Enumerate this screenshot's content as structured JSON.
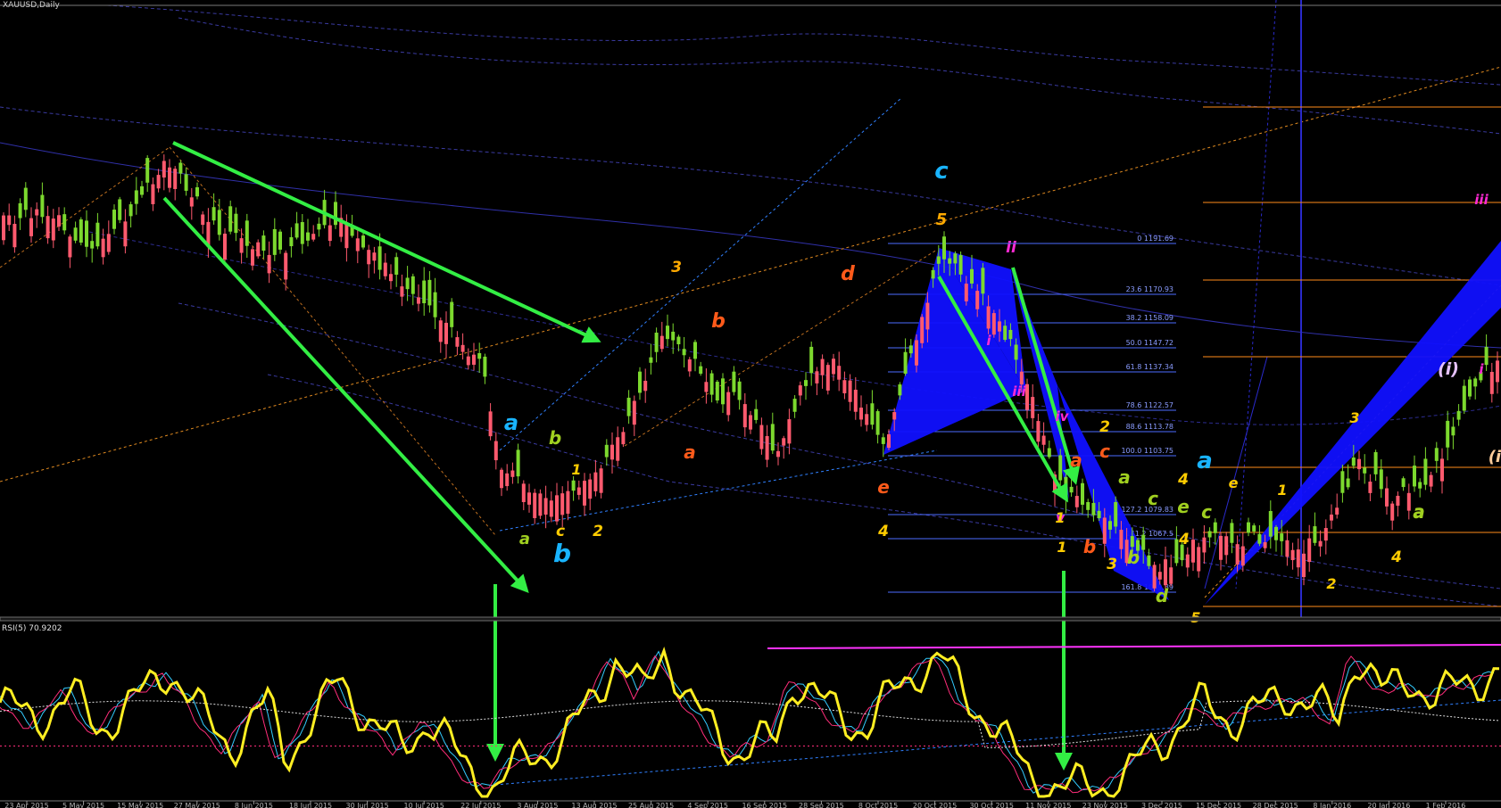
{
  "window": {
    "symbol_label": "XAUUSD,Daily"
  },
  "colors": {
    "background": "#000000",
    "bull_candle": "#7cd92e",
    "bear_candle": "#ff5a6e",
    "arrow": "#33ee44",
    "fib_line": "#4d6cff",
    "pattern_fill": "#1010ff",
    "rsi_line": "#ffee22",
    "rsi_signal_a": "#33ccff",
    "rsi_signal_b": "#ff2d7a",
    "rsi_level": "#ff33ff",
    "orange_level": "#ff8c1a"
  },
  "rsi_panel": {
    "label": "RSI(5) 70.9202"
  },
  "fib_levels": [
    {
      "label": "0 1191.69"
    },
    {
      "label": "23.6 1170.93"
    },
    {
      "label": "38.2 1158.09"
    },
    {
      "label": "50.0 1147.72"
    },
    {
      "label": "61.8 1137.34"
    },
    {
      "label": "78.6 1122.57"
    },
    {
      "label": "88.6 1113.78"
    },
    {
      "label": "100.0 1103.75"
    },
    {
      "label": "127.2 1079.83"
    },
    {
      "label": "141.2 1067.5"
    },
    {
      "label": "161.8 1049.39"
    }
  ],
  "wave_labels": [
    {
      "text": "c"
    },
    {
      "text": "a"
    },
    {
      "text": "b"
    },
    {
      "text": "3"
    },
    {
      "text": "b"
    },
    {
      "text": "d"
    },
    {
      "text": "5"
    },
    {
      "text": "ii"
    },
    {
      "text": "i"
    },
    {
      "text": "iii"
    },
    {
      "text": "iv"
    },
    {
      "text": "a"
    },
    {
      "text": "c"
    },
    {
      "text": "2"
    },
    {
      "text": "a"
    },
    {
      "text": "c"
    },
    {
      "text": "e"
    },
    {
      "text": "4"
    },
    {
      "text": "a"
    },
    {
      "text": "b"
    },
    {
      "text": "1"
    },
    {
      "text": "a"
    },
    {
      "text": "c"
    },
    {
      "text": "2"
    },
    {
      "text": "e"
    },
    {
      "text": "4"
    },
    {
      "text": "1"
    },
    {
      "text": "b"
    },
    {
      "text": "3"
    },
    {
      "text": "b"
    },
    {
      "text": "d"
    },
    {
      "text": "5"
    },
    {
      "text": "a"
    },
    {
      "text": "4"
    },
    {
      "text": "a"
    },
    {
      "text": "c"
    },
    {
      "text": "e"
    },
    {
      "text": "v"
    },
    {
      "text": "1"
    },
    {
      "text": "3"
    },
    {
      "text": "1"
    },
    {
      "text": "2"
    },
    {
      "text": "a"
    },
    {
      "text": "4"
    },
    {
      "text": "(i)"
    },
    {
      "text": "i"
    },
    {
      "text": "iii"
    },
    {
      "text": "(ii"
    }
  ],
  "x_axis_labels": [
    "23 Apr 2015",
    "5 May 2015",
    "15 May 2015",
    "27 May 2015",
    "8 Jun 2015",
    "18 Jun 2015",
    "30 Jun 2015",
    "10 Jul 2015",
    "22 Jul 2015",
    "3 Aug 2015",
    "13 Aug 2015",
    "25 Aug 2015",
    "4 Sep 2015",
    "16 Sep 2015",
    "28 Sep 2015",
    "8 Oct 2015",
    "20 Oct 2015",
    "30 Oct 2015",
    "11 Nov 2015",
    "23 Nov 2015",
    "3 Dec 2015",
    "15 Dec 2015",
    "28 Dec 2015",
    "8 Jan 2016",
    "20 Jan 2016",
    "1 Feb 2016"
  ],
  "chart_data": {
    "type": "candlestick",
    "symbol": "XAUUSD",
    "timeframe": "Daily",
    "x_range": [
      "2015-04-07",
      "2016-02-03"
    ],
    "fib_retracement": {
      "high": 1191.69,
      "low": 1103.75,
      "levels": [
        {
          "ratio": 0,
          "price": 1191.69
        },
        {
          "ratio": 23.6,
          "price": 1170.93
        },
        {
          "ratio": 38.2,
          "price": 1158.09
        },
        {
          "ratio": 50.0,
          "price": 1147.72
        },
        {
          "ratio": 61.8,
          "price": 1137.34
        },
        {
          "ratio": 78.6,
          "price": 1122.57
        },
        {
          "ratio": 88.6,
          "price": 1113.78
        },
        {
          "ratio": 100.0,
          "price": 1103.75
        },
        {
          "ratio": 127.2,
          "price": 1079.83
        },
        {
          "ratio": 141.2,
          "price": 1067.5
        },
        {
          "ratio": 161.8,
          "price": 1049.39
        }
      ]
    },
    "rsi": {
      "period": 5,
      "last_value": 70.9202,
      "range": [
        0,
        100
      ]
    },
    "grid": false
  }
}
